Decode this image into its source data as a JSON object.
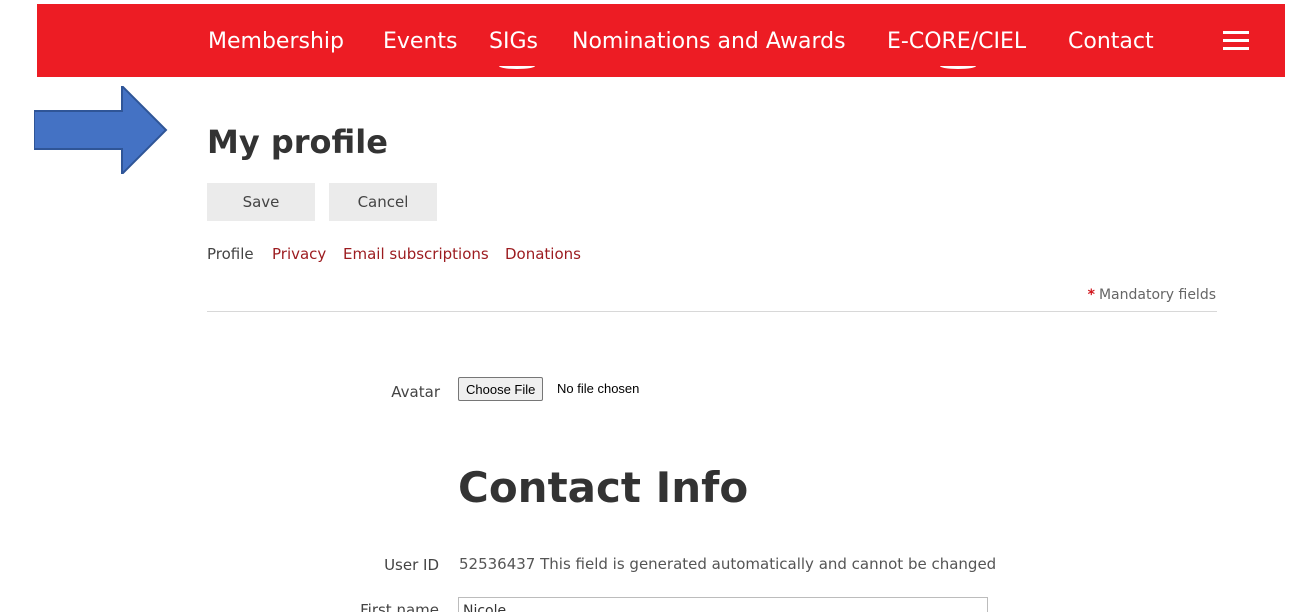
{
  "nav": {
    "items": [
      {
        "label": "Membership",
        "active": false
      },
      {
        "label": "Events",
        "active": false
      },
      {
        "label": "SIGs",
        "active": true
      },
      {
        "label": "Nominations and Awards",
        "active": false
      },
      {
        "label": "E-CORE/CIEL",
        "active": true
      },
      {
        "label": "Contact",
        "active": false
      }
    ],
    "menu_icon": "hamburger-menu-icon",
    "background_color": "#ed1c24"
  },
  "annotation": {
    "arrow_icon": "right-arrow-icon",
    "arrow_color": "#4472c4"
  },
  "page": {
    "title": "My profile"
  },
  "actions": {
    "save_label": "Save",
    "cancel_label": "Cancel"
  },
  "tabs": [
    {
      "label": "Profile",
      "active": true
    },
    {
      "label": "Privacy",
      "active": false
    },
    {
      "label": "Email subscriptions",
      "active": false
    },
    {
      "label": "Donations",
      "active": false
    }
  ],
  "mandatory": {
    "marker": "*",
    "text": "Mandatory fields"
  },
  "avatar": {
    "label": "Avatar",
    "button_label": "Choose File",
    "status": "No file chosen"
  },
  "contact": {
    "title": "Contact Info",
    "user_id_label": "User ID",
    "user_id_value": "52536437 This field is generated automatically and cannot be changed",
    "first_name_label": "First name",
    "first_name_value": "Nicole"
  }
}
